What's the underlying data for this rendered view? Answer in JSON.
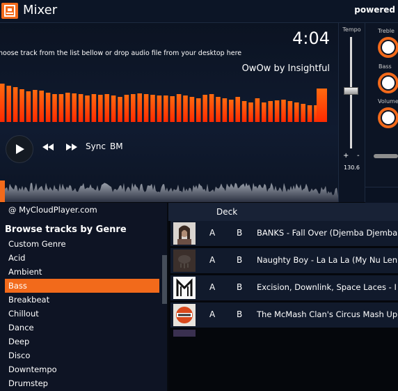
{
  "app": {
    "title": "Mixer",
    "powered": "powered"
  },
  "deck": {
    "time": "4:04",
    "hint": "hoose track from the list bellow or drop audio file from your desktop here",
    "track_title": "OwOw by Insightful",
    "sync_label": "Sync",
    "bm_label": "BM",
    "accent": "#f26a1b"
  },
  "tempo": {
    "label": "Tempo",
    "plus": "+",
    "minus": "-",
    "value": "130.6"
  },
  "eq": {
    "treble_label": "Treble",
    "bass_label": "Bass",
    "volume_label": "Volume"
  },
  "library": {
    "site": "@ MyCloudPlayer.com",
    "browse_title": "Browse tracks by Genre",
    "genres": [
      "Custom Genre",
      "Acid",
      "Ambient",
      "Bass",
      "Breakbeat",
      "Chillout",
      "Dance",
      "Deep",
      "Disco",
      "Downtempo",
      "Drumstep"
    ],
    "selected_genre": "Bass"
  },
  "tracks": {
    "header_deck": "Deck",
    "rows": [
      {
        "a": "A",
        "b": "B",
        "title": "BANKS - Fall Over (Djemba Djemba"
      },
      {
        "a": "A",
        "b": "B",
        "title": "Naughty Boy - La La La (My Nu Len"
      },
      {
        "a": "A",
        "b": "B",
        "title": "Excision, Downlink, Space Laces - I"
      },
      {
        "a": "A",
        "b": "B",
        "title": "The McMash Clan's Circus Mash Up"
      }
    ]
  }
}
